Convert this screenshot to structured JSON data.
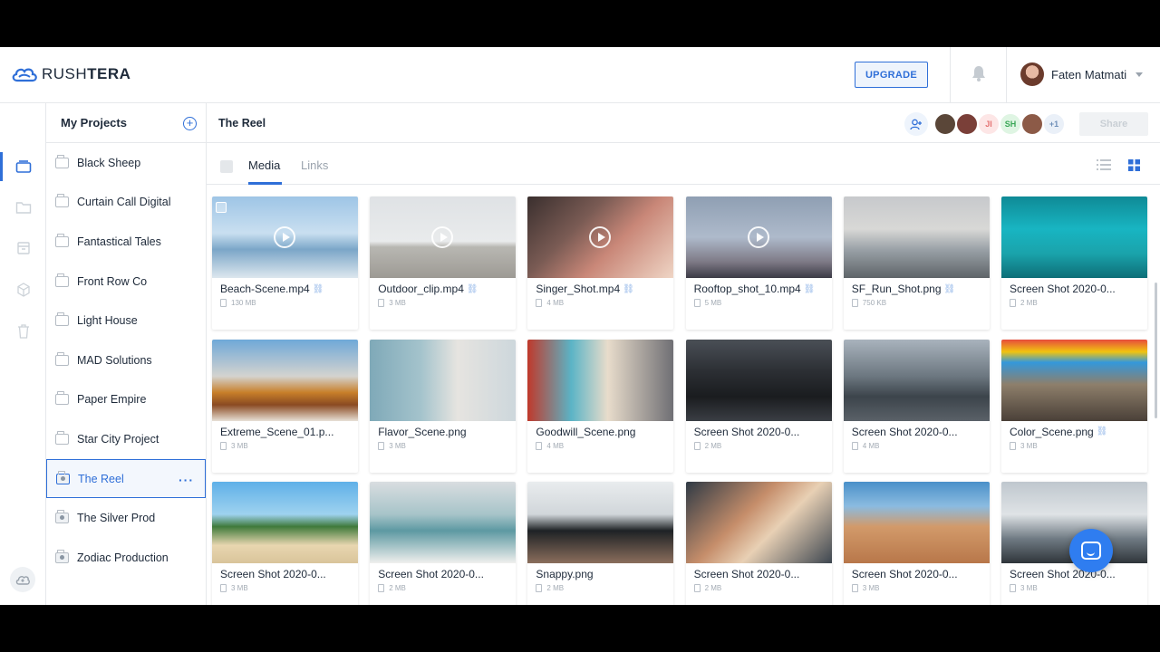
{
  "app": {
    "logo_text_light": "RUSH",
    "logo_text_bold": "TERA"
  },
  "topbar": {
    "upgrade_label": "UPGRADE",
    "user_name": "Faten Matmati"
  },
  "sidebar": {
    "title": "My Projects",
    "projects": [
      {
        "label": "Black Sheep",
        "type": "folder"
      },
      {
        "label": "Curtain Call Digital",
        "type": "folder"
      },
      {
        "label": "Fantastical Tales",
        "type": "folder"
      },
      {
        "label": "Front Row Co",
        "type": "folder"
      },
      {
        "label": "Light House",
        "type": "folder"
      },
      {
        "label": "MAD Solutions",
        "type": "folder"
      },
      {
        "label": "Paper Empire",
        "type": "folder"
      },
      {
        "label": "Star City Project",
        "type": "folder"
      },
      {
        "label": "The Reel",
        "type": "team",
        "active": true
      },
      {
        "label": "The Silver Prod",
        "type": "team"
      },
      {
        "label": "Zodiac Production",
        "type": "team"
      }
    ],
    "more_label": "···"
  },
  "main": {
    "title": "The Reel",
    "members": [
      {
        "initials": "",
        "color": "#5a4638"
      },
      {
        "initials": "",
        "color": "#7a3f38"
      },
      {
        "initials": "JI",
        "color": "#fde6e6",
        "text_color": "#e57373"
      },
      {
        "initials": "SH",
        "color": "#dff5e3",
        "text_color": "#3aa757"
      },
      {
        "initials": "",
        "color": "#8c5a47"
      },
      {
        "initials": "+1",
        "color": "#eaf0f8",
        "text_color": "#6f8fb8"
      }
    ],
    "share_label": "Share",
    "tabs": [
      {
        "label": "Media",
        "active": true
      },
      {
        "label": "Links",
        "active": false
      }
    ]
  },
  "files": [
    {
      "name": "Beach-Scene.mp4",
      "size": "130 MB",
      "video": true,
      "link": true,
      "checkbox": true
    },
    {
      "name": "Outdoor_clip.mp4",
      "size": "3 MB",
      "video": true,
      "link": true
    },
    {
      "name": "Singer_Shot.mp4",
      "size": "4 MB",
      "video": true,
      "link": true
    },
    {
      "name": "Rooftop_shot_10.mp4",
      "size": "5 MB",
      "video": true,
      "link": true
    },
    {
      "name": "SF_Run_Shot.png",
      "size": "750 KB",
      "video": false,
      "link": true
    },
    {
      "name": "Screen Shot 2020-0...",
      "size": "2 MB",
      "video": false,
      "link": false
    },
    {
      "name": "Extreme_Scene_01.p...",
      "size": "3 MB",
      "video": false,
      "link": false
    },
    {
      "name": "Flavor_Scene.png",
      "size": "3 MB",
      "video": false,
      "link": false
    },
    {
      "name": "Goodwill_Scene.png",
      "size": "4 MB",
      "video": false,
      "link": false
    },
    {
      "name": "Screen Shot 2020-0...",
      "size": "2 MB",
      "video": false,
      "link": false
    },
    {
      "name": "Screen Shot 2020-0...",
      "size": "4 MB",
      "video": false,
      "link": false
    },
    {
      "name": "Color_Scene.png",
      "size": "3 MB",
      "video": false,
      "link": true
    },
    {
      "name": "Screen Shot 2020-0...",
      "size": "3 MB",
      "video": false,
      "link": false
    },
    {
      "name": "Screen Shot 2020-0...",
      "size": "2 MB",
      "video": false,
      "link": false
    },
    {
      "name": "Snappy.png",
      "size": "2 MB",
      "video": false,
      "link": false
    },
    {
      "name": "Screen Shot 2020-0...",
      "size": "2 MB",
      "video": false,
      "link": false
    },
    {
      "name": "Screen Shot 2020-0...",
      "size": "3 MB",
      "video": false,
      "link": false
    },
    {
      "name": "Screen Shot 2020-0...",
      "size": "3 MB",
      "video": false,
      "link": false
    }
  ],
  "colors": {
    "accent": "#2f6fd8",
    "text": "#1e2a3a",
    "muted": "#9aa3ad"
  }
}
